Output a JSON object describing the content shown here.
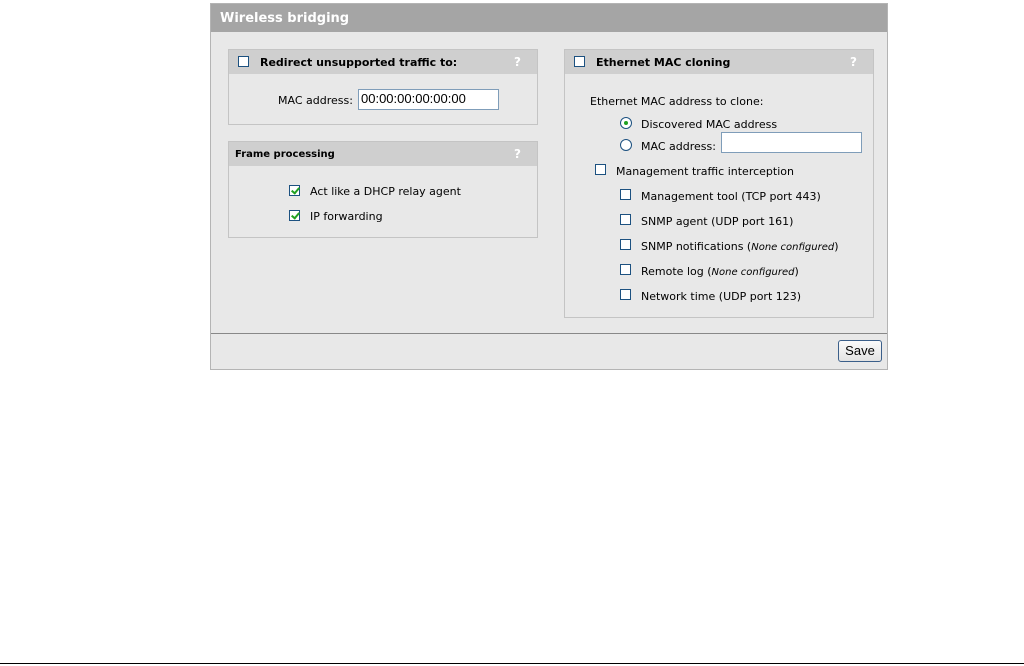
{
  "panel": {
    "title": "Wireless bridging"
  },
  "redirect": {
    "label": "Redirect unsupported traffic to:",
    "help": "?",
    "mac_label": "MAC address:",
    "mac_value": "00:00:00:00:00:00",
    "checked": false
  },
  "frame": {
    "title": "Frame processing",
    "help": "?",
    "dhcp_label": "Act like a DHCP relay agent",
    "dhcp_checked": true,
    "ipfwd_label": "IP forwarding",
    "ipfwd_checked": true
  },
  "cloning": {
    "label": "Ethernet MAC cloning",
    "help": "?",
    "checked": false,
    "clone_label": "Ethernet MAC address to clone:",
    "discovered_label": "Discovered MAC address",
    "mac_option_label": "MAC address:",
    "mac_value": "",
    "selected_option": "Discovered MAC address",
    "interception_label": "Management traffic interception",
    "items": [
      {
        "label": "Management tool (TCP port 443)",
        "note": ""
      },
      {
        "label": "SNMP agent (UDP port 161)",
        "note": ""
      },
      {
        "label": "SNMP notifications",
        "note": "None configured"
      },
      {
        "label": "Remote log",
        "note": "None configured"
      },
      {
        "label": "Network time (UDP port 123)",
        "note": ""
      }
    ]
  },
  "footer": {
    "save_label": "Save"
  }
}
